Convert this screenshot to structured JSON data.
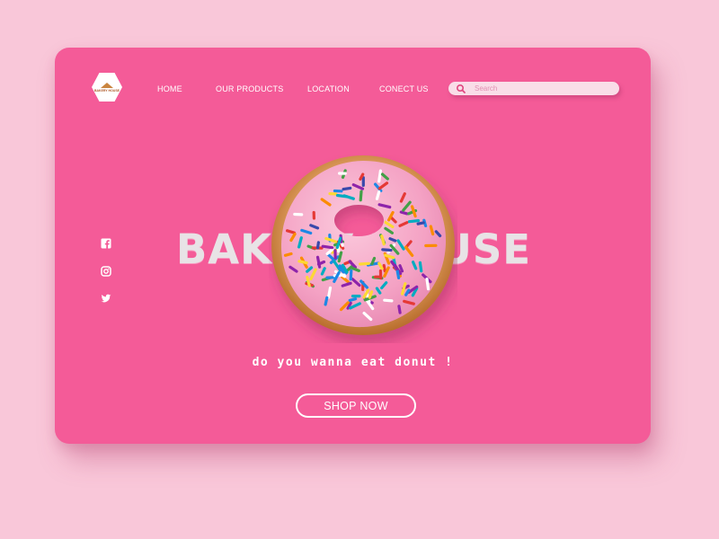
{
  "header": {
    "logo": {
      "text": "BAKERY HOUSE",
      "icon": "bakery-logo"
    },
    "nav": [
      {
        "label": "HOME"
      },
      {
        "label": "OUR PRODUCTS"
      },
      {
        "label": "LOCATION"
      },
      {
        "label": "CONECT US"
      }
    ],
    "search": {
      "placeholder": "Search",
      "icon": "search-icon"
    }
  },
  "social": [
    {
      "icon": "facebook-icon"
    },
    {
      "icon": "instagram-icon"
    },
    {
      "icon": "twitter-icon"
    }
  ],
  "hero": {
    "brand_visible_left": "BAK",
    "brand_visible_right": "Y HOUSE",
    "tagline": "do you wanna eat donut !",
    "cta_label": "SHOP NOW"
  },
  "colors": {
    "page_background": "#f9c7d9",
    "card_background": "#f45b98",
    "frosting": "#f5a8c8",
    "accent_text": "#e8e3e6"
  }
}
